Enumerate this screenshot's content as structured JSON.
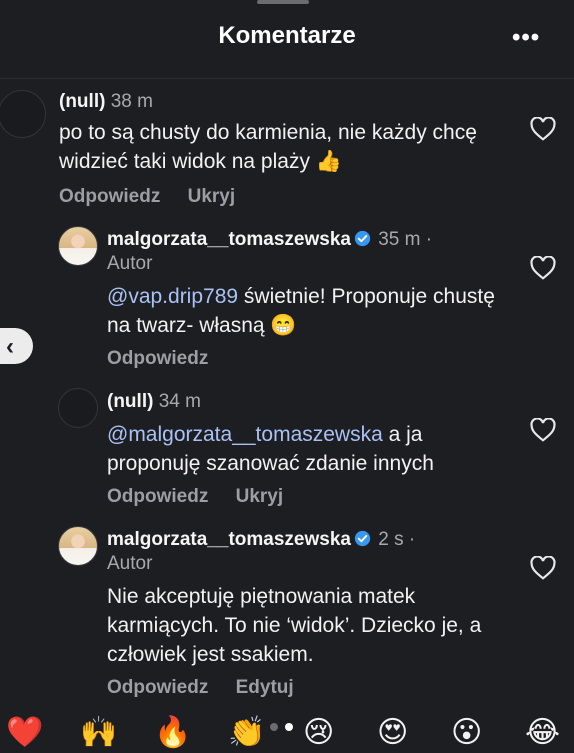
{
  "header": {
    "title": "Komentarze",
    "more_label": "•••"
  },
  "comments": [
    {
      "user": "(null)",
      "time": "38 m",
      "text": "po to są chusty do karmienia, nie każdy chcę widzieć taki widok na plaży 👍",
      "actions": [
        "Odpowiedz",
        "Ukryj"
      ]
    },
    {
      "user": "malgorzata__tomaszewska",
      "verified": true,
      "time": "35 m ·",
      "author_tag": "Autor",
      "mention": "@vap.drip789",
      "text": " świetnie! Proponuje chustę na twarz- własną 😁",
      "actions": [
        "Odpowiedz"
      ]
    },
    {
      "user": "(null)",
      "time": "34 m",
      "mention": "@malgorzata__tomaszewska",
      "text": " a ja proponuję szanować zdanie innych",
      "actions": [
        "Odpowiedz",
        "Ukryj"
      ]
    },
    {
      "user": "malgorzata__tomaszewska",
      "verified": true,
      "time": "2 s ·",
      "author_tag": "Autor",
      "text": "Nie akceptuję piętnowania matek karmiących. To nie ‘widok’. Dziecko je, a człowiek jest ssakiem.",
      "actions": [
        "Odpowiedz",
        "Edytuj"
      ]
    }
  ],
  "back_button_glyph": "‹",
  "reactions": [
    "❤️",
    "🙌",
    "🔥",
    "👏",
    "😢",
    "😍",
    "😮",
    "😂"
  ],
  "pager": {
    "pages": 2,
    "active": 2
  },
  "colors": {
    "background": "#1d1e22",
    "mention": "#a9c1f5",
    "verified": "#3897f0",
    "secondary_text": "#a8a9ad"
  }
}
